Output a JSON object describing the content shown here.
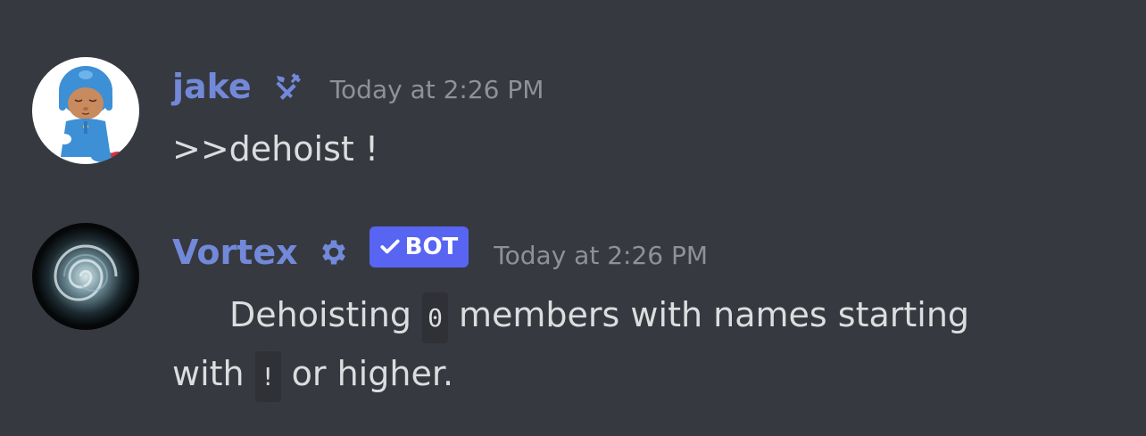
{
  "messages": [
    {
      "username": "jake",
      "role_icon": "hammer-wrench-icon",
      "timestamp": "Today at 2:26 PM",
      "content": ">>dehoist !"
    },
    {
      "username": "Vortex",
      "role_icon": "gear-icon",
      "bot_tag": "BOT",
      "timestamp": "Today at 2:26 PM",
      "content_parts": {
        "text_1": "Dehoisting ",
        "code_1": "0",
        "text_2": " members with names starting with ",
        "code_2": "!",
        "text_3": " or higher."
      }
    }
  ],
  "colors": {
    "background": "#36393f",
    "username": "#7289da",
    "bot_tag": "#5865f2",
    "timestamp": "#8e9297",
    "text": "#dcddde"
  }
}
